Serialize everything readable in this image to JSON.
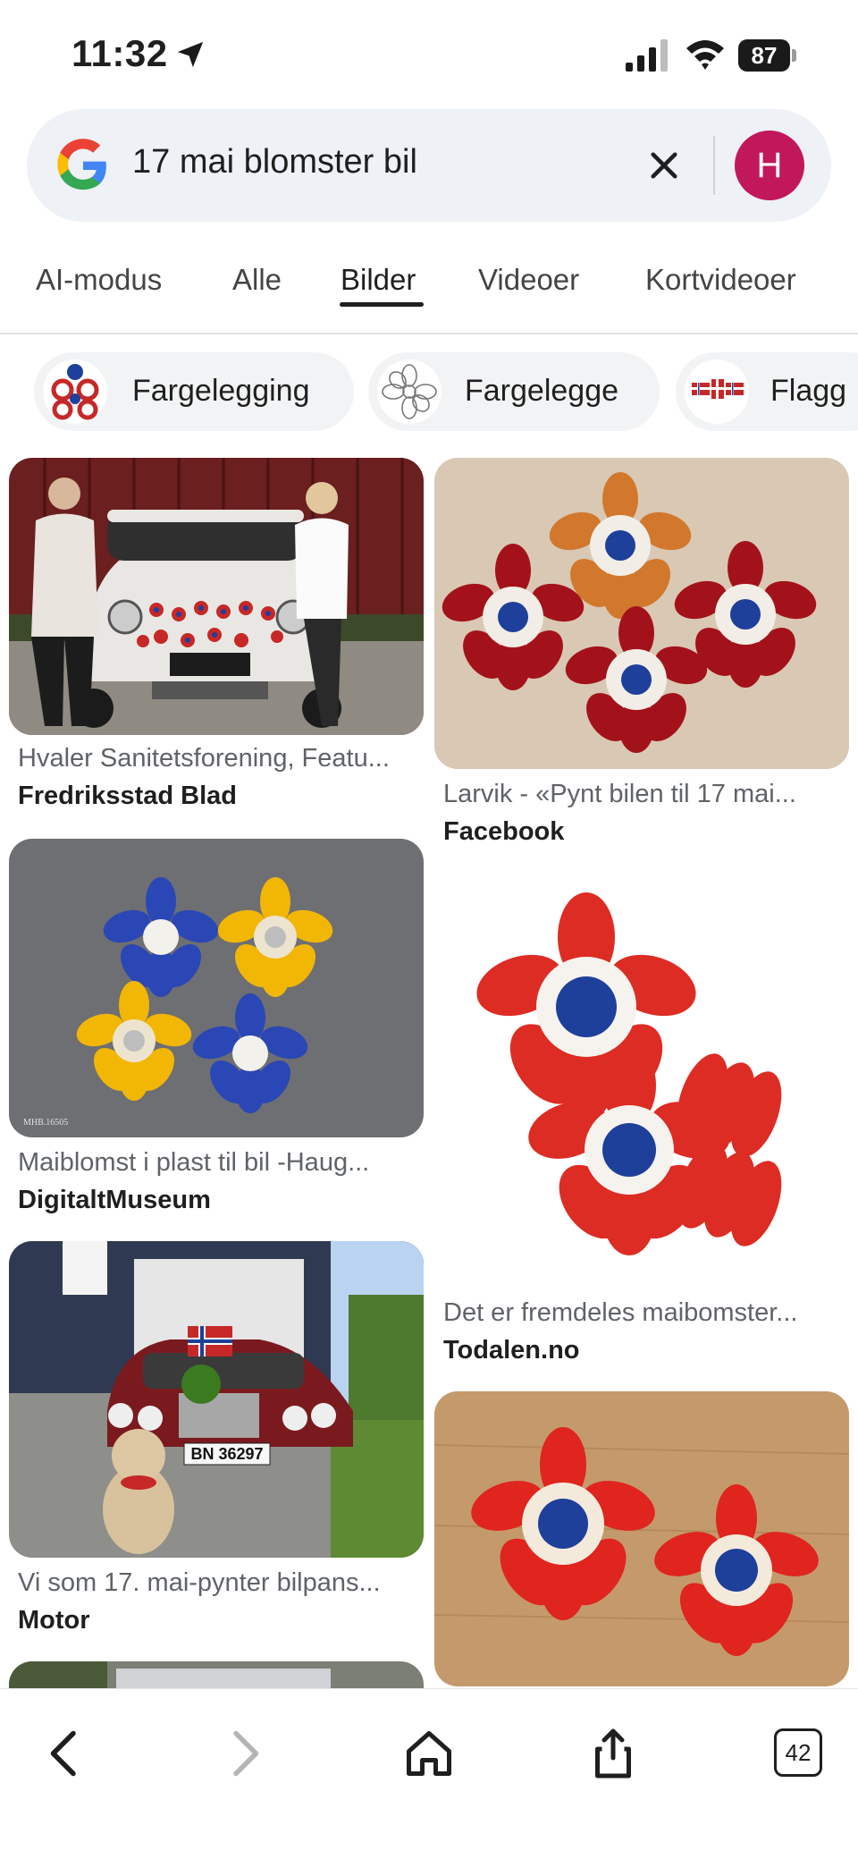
{
  "status_bar": {
    "time": "11:32",
    "battery": "87"
  },
  "search": {
    "query": "17 mai blomster bil",
    "avatar_letter": "H"
  },
  "tabs": [
    {
      "label": "AI-modus"
    },
    {
      "label": "Alle"
    },
    {
      "label": "Bilder",
      "active": true
    },
    {
      "label": "Videoer"
    },
    {
      "label": "Kortvideoer"
    }
  ],
  "chips": [
    {
      "label": "Fargelegging"
    },
    {
      "label": "Fargelegge"
    },
    {
      "label": "Flagg"
    }
  ],
  "results": [
    {
      "caption": "Hvaler Sanitetsforening, Featu...",
      "source": "Fredriksstad Blad"
    },
    {
      "caption": "Larvik - «Pynt bilen til 17 mai...",
      "source": "Facebook"
    },
    {
      "caption": "Maiblomst i plast til bil -Haug...",
      "source": "DigitaltMuseum",
      "image_label": "MHB.16505"
    },
    {
      "caption": "Det er fremdeles maibomster...",
      "source": "Todalen.no"
    },
    {
      "caption": "Vi som 17. mai-pynter bilpans...",
      "source": "Motor",
      "plate": "BN 36297"
    },
    {
      "caption": "",
      "source": ""
    }
  ],
  "bottom_bar": {
    "tab_count": "42"
  },
  "colors": {
    "accent": "#c2185b",
    "flower_red": "#d32f2f",
    "flower_blue": "#1e3f9a",
    "flower_yellow": "#f2b705"
  }
}
